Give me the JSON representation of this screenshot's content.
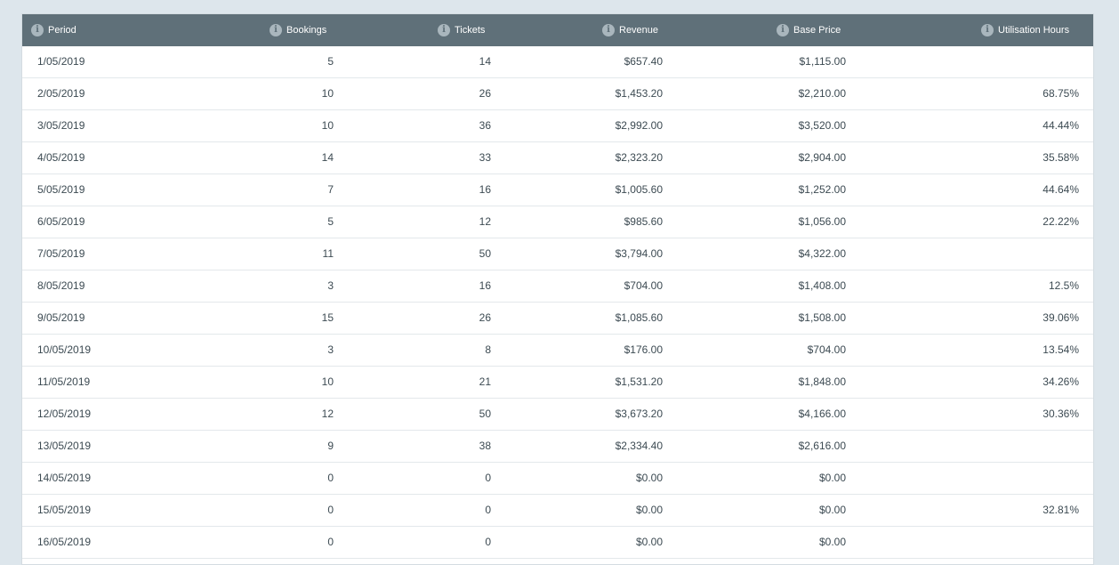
{
  "table": {
    "columns": [
      "Period",
      "Bookings",
      "Tickets",
      "Revenue",
      "Base Price",
      "Utilisation Hours"
    ],
    "rows": [
      {
        "period": "1/05/2019",
        "bookings": "5",
        "tickets": "14",
        "revenue": "$657.40",
        "base_price": "$1,115.00",
        "utilisation": ""
      },
      {
        "period": "2/05/2019",
        "bookings": "10",
        "tickets": "26",
        "revenue": "$1,453.20",
        "base_price": "$2,210.00",
        "utilisation": "68.75%"
      },
      {
        "period": "3/05/2019",
        "bookings": "10",
        "tickets": "36",
        "revenue": "$2,992.00",
        "base_price": "$3,520.00",
        "utilisation": "44.44%"
      },
      {
        "period": "4/05/2019",
        "bookings": "14",
        "tickets": "33",
        "revenue": "$2,323.20",
        "base_price": "$2,904.00",
        "utilisation": "35.58%"
      },
      {
        "period": "5/05/2019",
        "bookings": "7",
        "tickets": "16",
        "revenue": "$1,005.60",
        "base_price": "$1,252.00",
        "utilisation": "44.64%"
      },
      {
        "period": "6/05/2019",
        "bookings": "5",
        "tickets": "12",
        "revenue": "$985.60",
        "base_price": "$1,056.00",
        "utilisation": "22.22%"
      },
      {
        "period": "7/05/2019",
        "bookings": "11",
        "tickets": "50",
        "revenue": "$3,794.00",
        "base_price": "$4,322.00",
        "utilisation": ""
      },
      {
        "period": "8/05/2019",
        "bookings": "3",
        "tickets": "16",
        "revenue": "$704.00",
        "base_price": "$1,408.00",
        "utilisation": "12.5%"
      },
      {
        "period": "9/05/2019",
        "bookings": "15",
        "tickets": "26",
        "revenue": "$1,085.60",
        "base_price": "$1,508.00",
        "utilisation": "39.06%"
      },
      {
        "period": "10/05/2019",
        "bookings": "3",
        "tickets": "8",
        "revenue": "$176.00",
        "base_price": "$704.00",
        "utilisation": "13.54%"
      },
      {
        "period": "11/05/2019",
        "bookings": "10",
        "tickets": "21",
        "revenue": "$1,531.20",
        "base_price": "$1,848.00",
        "utilisation": "34.26%"
      },
      {
        "period": "12/05/2019",
        "bookings": "12",
        "tickets": "50",
        "revenue": "$3,673.20",
        "base_price": "$4,166.00",
        "utilisation": "30.36%"
      },
      {
        "period": "13/05/2019",
        "bookings": "9",
        "tickets": "38",
        "revenue": "$2,334.40",
        "base_price": "$2,616.00",
        "utilisation": ""
      },
      {
        "period": "14/05/2019",
        "bookings": "0",
        "tickets": "0",
        "revenue": "$0.00",
        "base_price": "$0.00",
        "utilisation": ""
      },
      {
        "period": "15/05/2019",
        "bookings": "0",
        "tickets": "0",
        "revenue": "$0.00",
        "base_price": "$0.00",
        "utilisation": "32.81%"
      },
      {
        "period": "16/05/2019",
        "bookings": "0",
        "tickets": "0",
        "revenue": "$0.00",
        "base_price": "$0.00",
        "utilisation": ""
      }
    ]
  },
  "icons": {
    "info": "info-icon"
  },
  "colors": {
    "header_bg": "#5f7079",
    "header_text": "#ffffff",
    "page_bg": "#dde6ec"
  }
}
